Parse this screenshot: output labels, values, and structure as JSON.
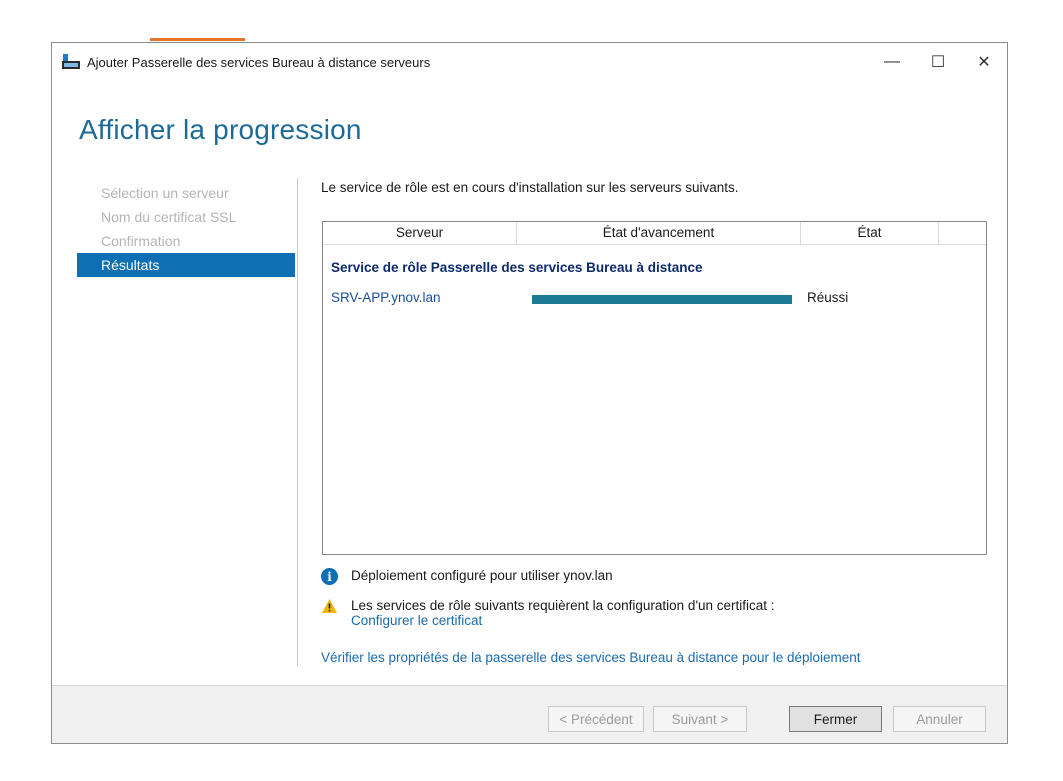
{
  "window": {
    "title": "Ajouter Passerelle des services Bureau à distance serveurs",
    "controls": {
      "minimize": "—",
      "maximize": "☐",
      "close": "✕"
    }
  },
  "page_title": "Afficher la progression",
  "nav": {
    "items": [
      {
        "label": "Sélection un serveur",
        "active": false
      },
      {
        "label": "Nom du certificat SSL",
        "active": false
      },
      {
        "label": "Confirmation",
        "active": false
      },
      {
        "label": "Résultats",
        "active": true
      }
    ]
  },
  "intro": "Le service de rôle est en cours d'installation sur les serveurs suivants.",
  "table": {
    "headers": [
      "Serveur",
      "État d'avancement",
      "État"
    ],
    "group": "Service de rôle Passerelle des services Bureau à distance",
    "rows": [
      {
        "server": "SRV-APP.ynov.lan",
        "progress_fraction": 1.0,
        "status": "Réussi"
      }
    ]
  },
  "messages": {
    "info": "Déploiement configuré pour utiliser ynov.lan",
    "warning": "Les services de rôle suivants requièrent la configuration d'un certificat :",
    "warning_link": "Configurer le certificat",
    "verify_link": "Vérifier les propriétés de la passerelle des services Bureau à distance pour le déploiement"
  },
  "footer": {
    "previous": "< Précédent",
    "next": "Suivant >",
    "close": "Fermer",
    "cancel": "Annuler"
  },
  "colors": {
    "accent": "#0f6fb4",
    "title": "#1e6a97",
    "progress": "#1a7a94",
    "group_heading": "#0d2a6b",
    "link": "#1a6bb0"
  },
  "icons": {
    "app": "server-manager-icon",
    "info": "info-icon",
    "warning": "warning-icon"
  }
}
